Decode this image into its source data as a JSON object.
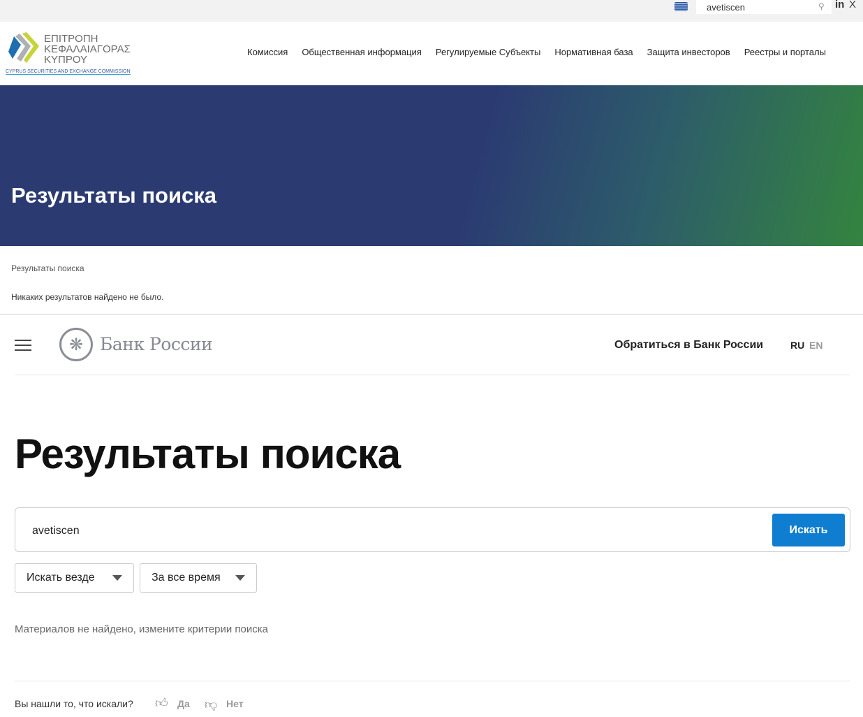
{
  "cysec": {
    "search_value": "avetiscen",
    "logo_greek": [
      "ΕΠΙΤΡΟΠΗ",
      "ΚΕΦΑΛΑΙΑΓΟΡΑΣ",
      "ΚΥΠΡΟΥ"
    ],
    "logo_english": "CYPRUS SECURITIES AND EXCHANGE COMMISSION",
    "social": {
      "linkedin": "in",
      "x": "X"
    },
    "nav": [
      "Комиссия",
      "Общественная информация",
      "Регулируемые Субъекты",
      "Нормативная база",
      "Защита инвесторов",
      "Реестры и порталы"
    ],
    "hero_title": "Результаты поиска",
    "breadcrumb": "Результаты поиска",
    "no_results": "Никаких результатов найдено не было."
  },
  "cbr": {
    "logo_text": "Банк России",
    "contact": "Обратиться в Банк России",
    "lang_ru": "RU",
    "lang_en": "EN",
    "title": "Результаты поиска",
    "search_value": "avetiscen",
    "search_button": "Искать",
    "filter_scope": "Искать везде",
    "filter_time": "За все время",
    "no_materials": "Материалов не найдено, измените критерии поиска",
    "feedback_question": "Вы нашли то, что искали?",
    "yes": "Да",
    "no": "Нет"
  }
}
